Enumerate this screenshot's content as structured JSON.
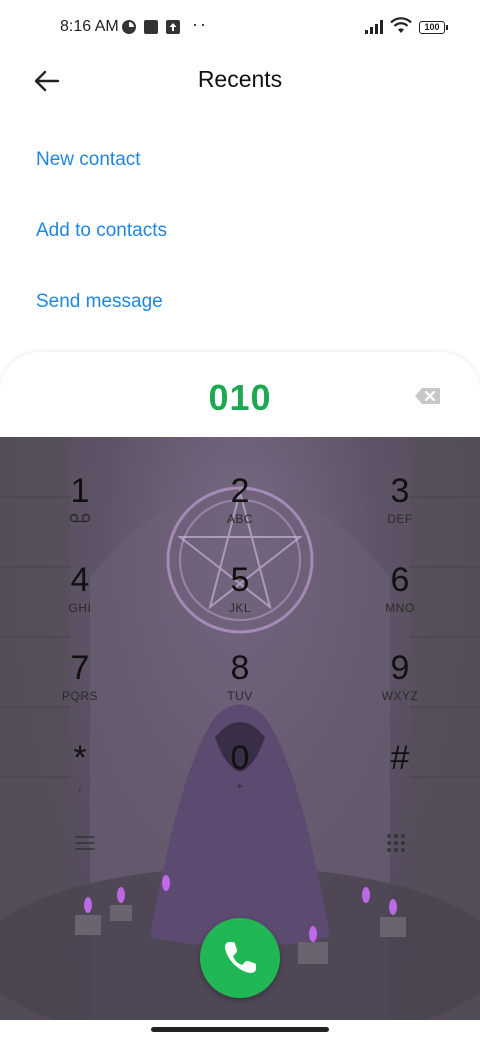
{
  "status_bar": {
    "time": "8:16 AM",
    "battery": "100",
    "dots": "··",
    "icons": [
      "app-icon",
      "square-icon",
      "upload-icon",
      "signal-icon",
      "wifi-icon",
      "battery-icon"
    ]
  },
  "header": {
    "title": "Recents",
    "back_icon": "back-arrow-icon"
  },
  "actions": [
    {
      "label": "New contact"
    },
    {
      "label": "Add to contacts"
    },
    {
      "label": "Send message"
    }
  ],
  "dialer": {
    "number": "010",
    "backspace_icon": "backspace-icon"
  },
  "keypad": {
    "keys": [
      {
        "digit": "1",
        "letters": ""
      },
      {
        "digit": "2",
        "letters": "ABC"
      },
      {
        "digit": "3",
        "letters": "DEF"
      },
      {
        "digit": "4",
        "letters": "GHI"
      },
      {
        "digit": "5",
        "letters": "JKL"
      },
      {
        "digit": "6",
        "letters": "MNO"
      },
      {
        "digit": "7",
        "letters": "PQRS"
      },
      {
        "digit": "8",
        "letters": "TUV"
      },
      {
        "digit": "9",
        "letters": "WXYZ"
      },
      {
        "digit": "*",
        "letters": ","
      },
      {
        "digit": "0",
        "letters": "+"
      },
      {
        "digit": "#",
        "letters": ""
      }
    ],
    "voicemail_icon": "voicemail-icon",
    "menu_icon": "menu-icon",
    "grid_icon": "dialpad-toggle-icon"
  },
  "call_button": {
    "icon": "phone-icon",
    "color": "#22b755"
  },
  "colors": {
    "accent_link": "#1f86e0",
    "number_green": "#1ea852"
  }
}
